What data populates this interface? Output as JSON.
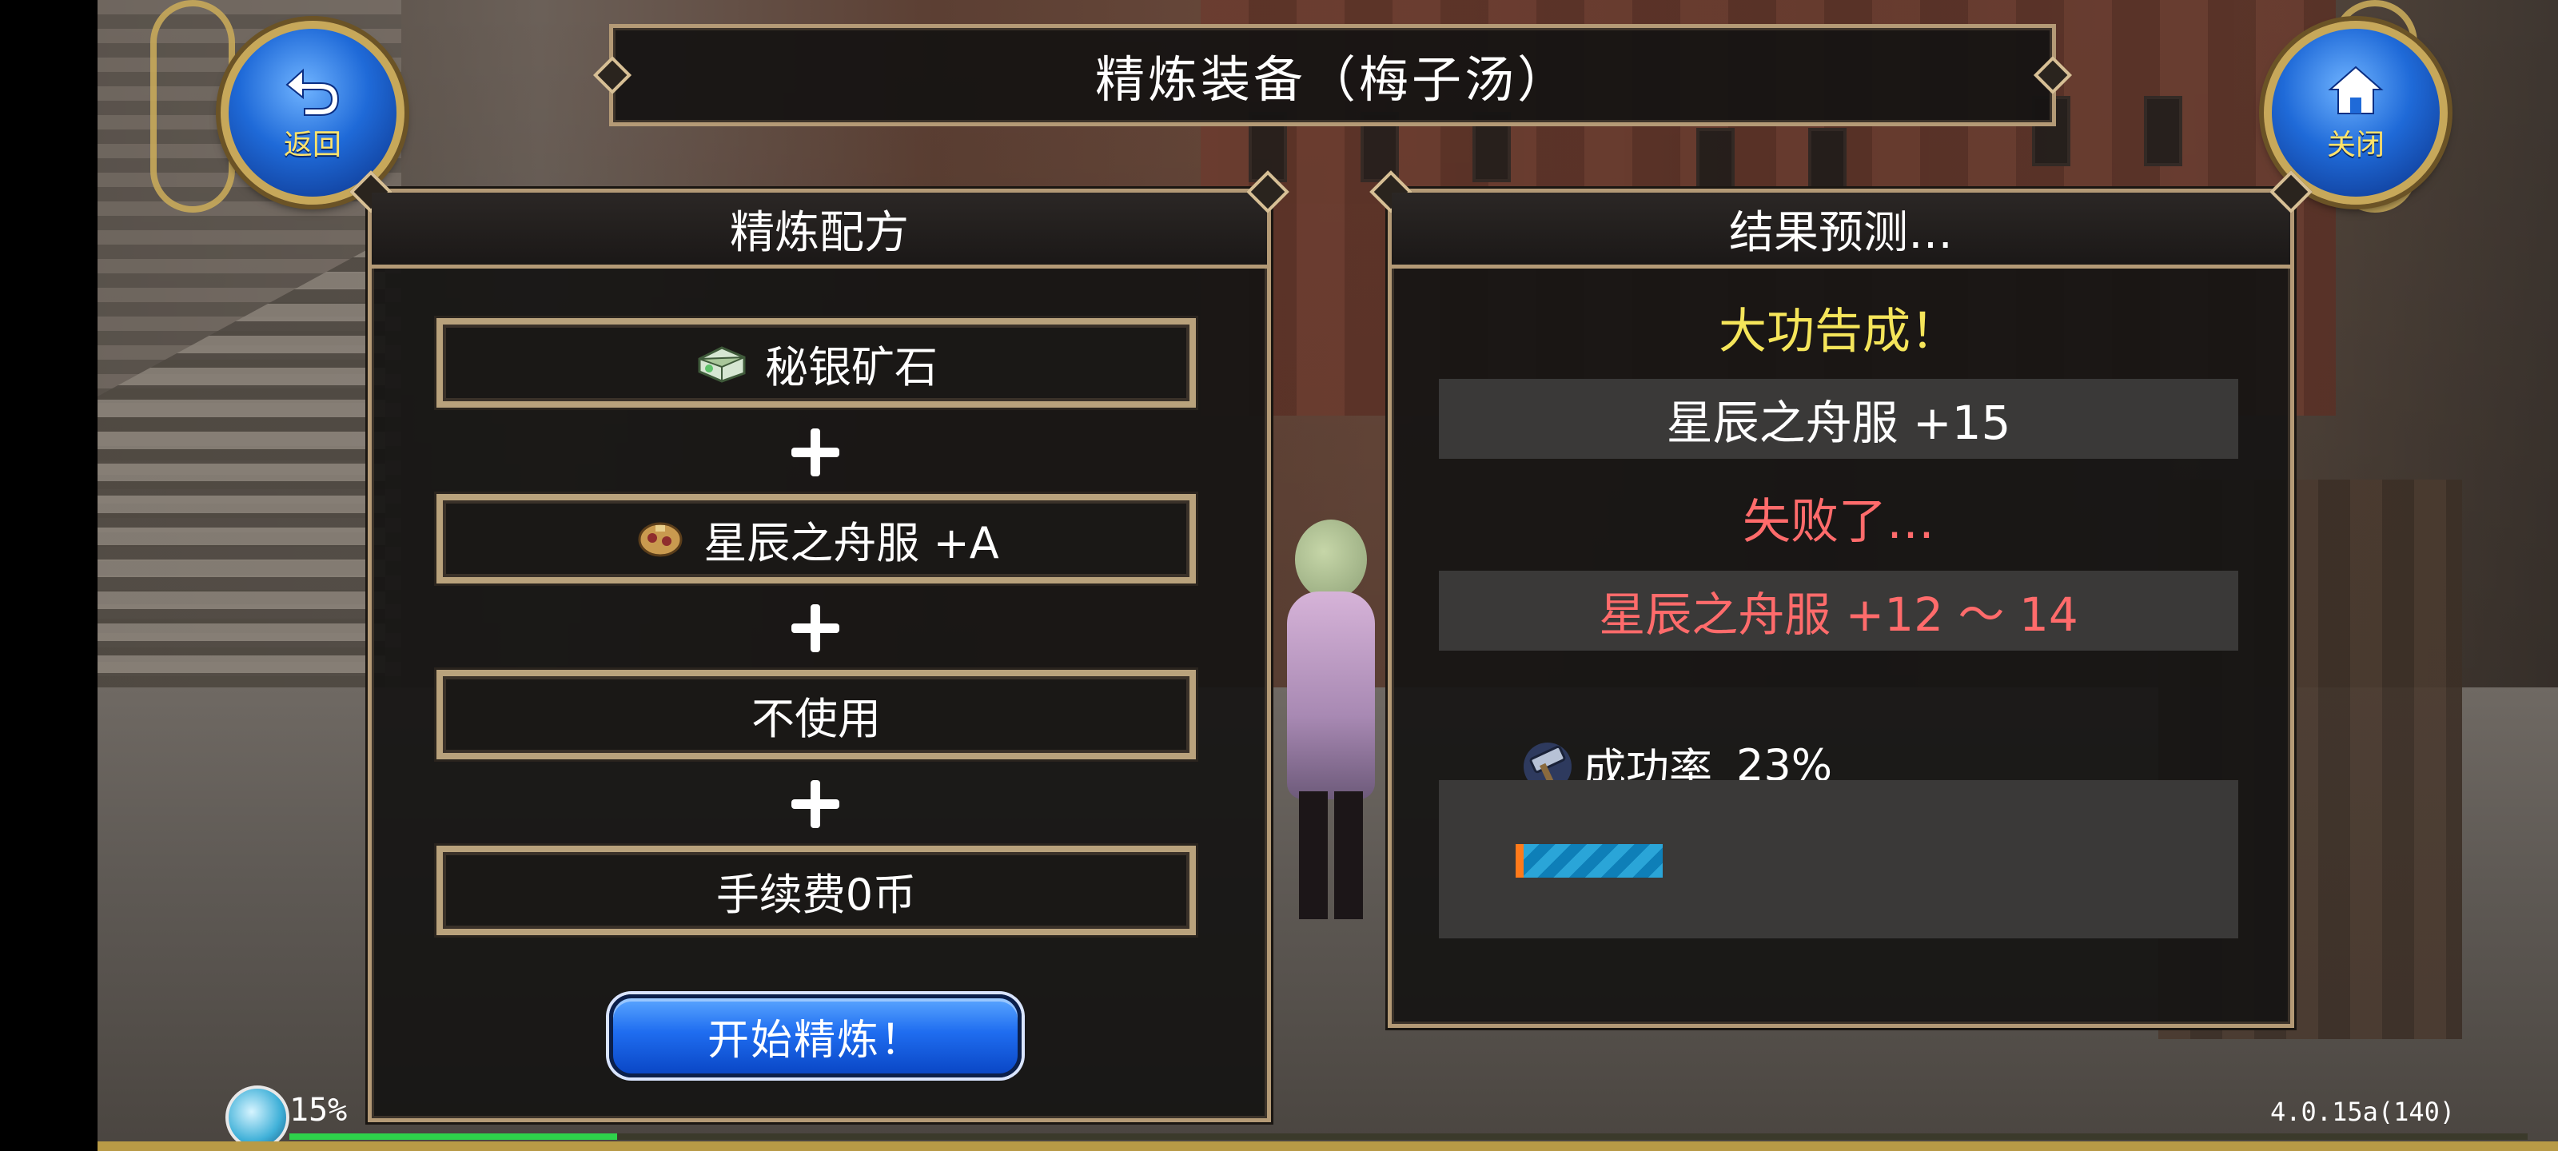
{
  "title": "精炼装备（梅子汤）",
  "back_button": {
    "label": "返回",
    "icon": "return-arrow-icon"
  },
  "close_button": {
    "label": "关闭",
    "icon": "home-icon"
  },
  "recipe_panel": {
    "header": "精炼配方",
    "rows": [
      {
        "label": "秘银矿石",
        "icon": "ore-icon"
      },
      {
        "label": "星辰之舟服 +A",
        "icon": "armor-icon"
      },
      {
        "label": "不使用",
        "icon": ""
      },
      {
        "label": "手续费0币",
        "icon": ""
      }
    ],
    "start_label": "开始精炼！"
  },
  "result_panel": {
    "header": "结果预测…",
    "success_heading": "大功告成！",
    "success_item": "星辰之舟服  +15",
    "fail_heading": "失败了…",
    "fail_item": "星辰之舟服  +12 ～ 14",
    "rate_label": "成功率",
    "rate_value": "23%",
    "rate_fraction": 0.23
  },
  "hud": {
    "percent": "15%",
    "exp_fraction": 0.15,
    "version": "4.0.15a(140)"
  },
  "colors": {
    "success": "#f5e55a",
    "fail": "#ff6b6b",
    "frame": "#b49a76",
    "button_blue": "#1f6df0"
  }
}
